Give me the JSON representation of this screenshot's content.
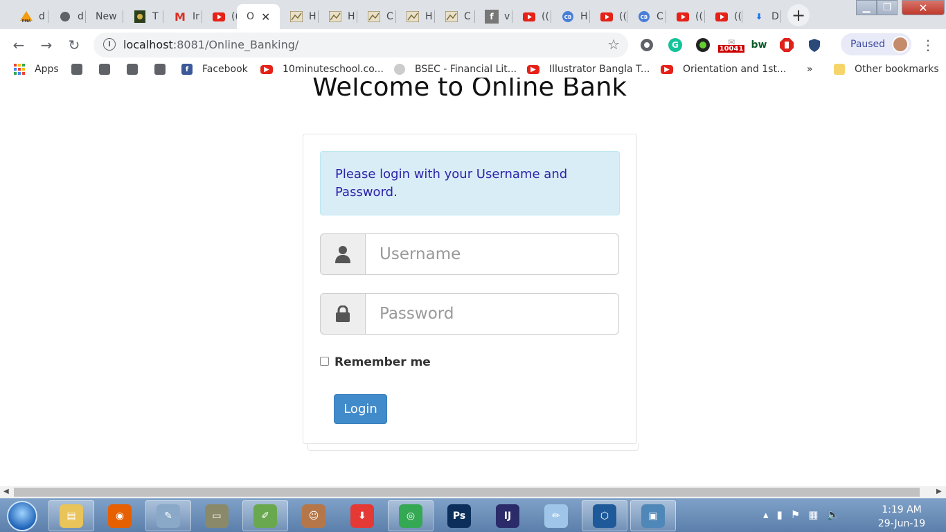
{
  "browser": {
    "tabs": [
      {
        "fav": "PMA",
        "favColor": "#f39c12",
        "label": "d"
      },
      {
        "fav": "globe",
        "favColor": "#5f6368",
        "label": "d"
      },
      {
        "fav": "",
        "favColor": "",
        "label": "New"
      },
      {
        "fav": "seal",
        "favColor": "#2c3e1a",
        "label": "T"
      },
      {
        "fav": "M",
        "favColor": "#d93025",
        "label": "Ir"
      },
      {
        "fav": "yt",
        "favColor": "#e62117",
        "label": "(("
      },
      {
        "fav": "",
        "favColor": "",
        "label": "O",
        "active": true
      },
      {
        "fav": "img",
        "favColor": "#7a6a3a",
        "label": "H"
      },
      {
        "fav": "img",
        "favColor": "#7a6a3a",
        "label": "H"
      },
      {
        "fav": "img",
        "favColor": "#7a6a3a",
        "label": "C"
      },
      {
        "fav": "img",
        "favColor": "#7a6a3a",
        "label": "H"
      },
      {
        "fav": "img",
        "favColor": "#7a6a3a",
        "label": "C"
      },
      {
        "fav": "f",
        "favColor": "#777",
        "label": "v"
      },
      {
        "fav": "yt",
        "favColor": "#e62117",
        "label": "(("
      },
      {
        "fav": "CB",
        "favColor": "#4a7fd8",
        "label": "H"
      },
      {
        "fav": "yt",
        "favColor": "#e62117",
        "label": "(("
      },
      {
        "fav": "CB",
        "favColor": "#4a7fd8",
        "label": "C"
      },
      {
        "fav": "yt",
        "favColor": "#e62117",
        "label": "(("
      },
      {
        "fav": "yt",
        "favColor": "#e62117",
        "label": "(("
      },
      {
        "fav": "dl",
        "favColor": "#1a73e8",
        "label": "D"
      }
    ],
    "url_host": "localhost",
    "url_rest": ":8081/Online_Banking/",
    "profile_label": "Paused",
    "ext_badge": "10041",
    "ext_bw": "bw"
  },
  "bookmarks": {
    "apps": "Apps",
    "facebook": "Facebook",
    "tenminute": "10minuteschool.co...",
    "bsec": "BSEC - Financial Lit...",
    "illustrator": "Illustrator Bangla T...",
    "orientation": "Orientation and 1st...",
    "more": "»",
    "other": "Other bookmarks"
  },
  "page": {
    "title": "Welcome to Online Bank",
    "alert": "Please login with your Username and Password.",
    "username_placeholder": "Username",
    "password_placeholder": "Password",
    "remember_label": "Remember me",
    "login_label": "Login"
  },
  "taskbar": {
    "apps": [
      {
        "name": "explorer",
        "color": "#e8c45a",
        "glyph": "▤"
      },
      {
        "name": "firefox",
        "color": "#e66000",
        "glyph": "◉"
      },
      {
        "name": "paint",
        "color": "#8aa8c8",
        "glyph": "✎"
      },
      {
        "name": "scanner",
        "color": "#8a8a6a",
        "glyph": "▭"
      },
      {
        "name": "notepad-plus",
        "color": "#6aa84f",
        "glyph": "✐"
      },
      {
        "name": "portrait",
        "color": "#b5774a",
        "glyph": "☺"
      },
      {
        "name": "downloader",
        "color": "#e53935",
        "glyph": "⬇"
      },
      {
        "name": "chrome",
        "color": "#34a853",
        "glyph": "◎"
      },
      {
        "name": "photoshop",
        "color": "#0b2f5a",
        "glyph": "Ps"
      },
      {
        "name": "intellij",
        "color": "#2b2b6a",
        "glyph": "IJ"
      },
      {
        "name": "notepad",
        "color": "#9fc6e8",
        "glyph": "✏"
      },
      {
        "name": "virtualbox",
        "color": "#1e5a9a",
        "glyph": "⬡"
      },
      {
        "name": "photo-viewer",
        "color": "#4f88b8",
        "glyph": "▣"
      }
    ],
    "time": "1:19 AM",
    "date": "29-Jun-19"
  }
}
